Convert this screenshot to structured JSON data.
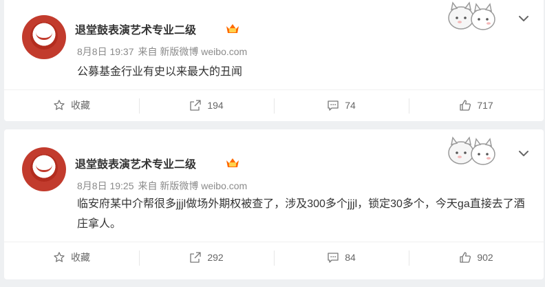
{
  "posts": [
    {
      "username": "退堂鼓表演艺术专业二级",
      "date": "8月8日 19:37",
      "source": "来自 新版微博 weibo.com",
      "content": "公募基金行业有史以来最大的丑闻",
      "actions": {
        "favorite": "收藏",
        "repost": "194",
        "comment": "74",
        "like": "717"
      }
    },
    {
      "username": "退堂鼓表演艺术专业二级",
      "date": "8月8日 19:25",
      "source": "来自 新版微博 weibo.com",
      "content": "临安府某中介帮很多jjjl做场外期权被查了，涉及300多个jjjl，锁定30多个，今天ga直接去了酒庄拿人。",
      "actions": {
        "favorite": "收藏",
        "repost": "292",
        "comment": "84",
        "like": "902"
      }
    }
  ],
  "icons": {
    "favorite": "star-outline-icon",
    "repost": "repost-icon",
    "comment": "comment-icon",
    "like": "thumbs-up-icon",
    "more": "chevron-down-icon",
    "vip": "vip-crown-icon"
  },
  "colors": {
    "accent": "#ff8200",
    "text": "#333333",
    "meta": "#8a8a8a"
  }
}
